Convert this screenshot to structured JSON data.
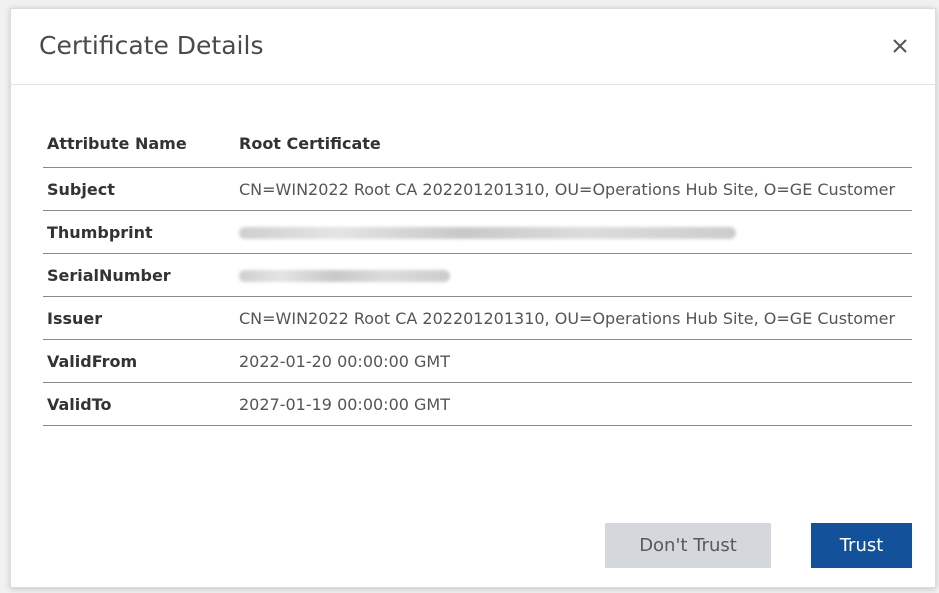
{
  "dialog": {
    "title": "Certificate Details",
    "close_icon": "close-icon"
  },
  "table": {
    "headers": {
      "attribute": "Attribute Name",
      "value": "Root Certificate"
    },
    "rows": [
      {
        "name": "Subject",
        "value": "CN=WIN2022 Root CA 202201201310, OU=Operations Hub Site, O=GE Customer",
        "redacted": false
      },
      {
        "name": "Thumbprint",
        "value": "",
        "redacted": true
      },
      {
        "name": "SerialNumber",
        "value": "",
        "redacted": true
      },
      {
        "name": "Issuer",
        "value": "CN=WIN2022 Root CA 202201201310, OU=Operations Hub Site, O=GE Customer",
        "redacted": false
      },
      {
        "name": "ValidFrom",
        "value": "2022-01-20 00:00:00 GMT",
        "redacted": false
      },
      {
        "name": "ValidTo",
        "value": "2027-01-19 00:00:00 GMT",
        "redacted": false
      }
    ]
  },
  "buttons": {
    "dont_trust": "Don't Trust",
    "trust": "Trust"
  },
  "colors": {
    "primary": "#13529b",
    "secondary": "#d4d7dc",
    "title_text": "#4a4a4a"
  }
}
